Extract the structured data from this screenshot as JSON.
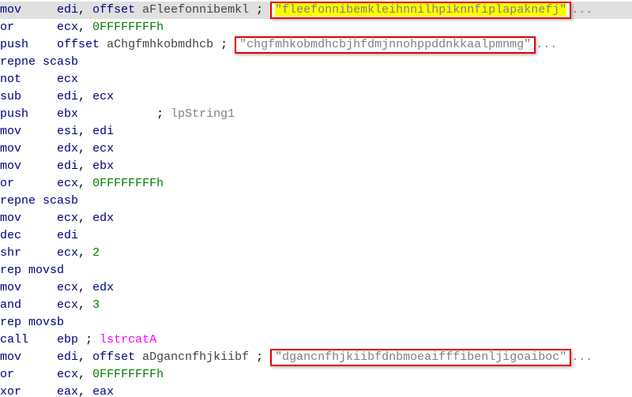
{
  "lines": [
    {
      "mnemonic": "mov",
      "ops": [
        "edi",
        "offset aFleefonnibemkl"
      ],
      "highlight": true,
      "comment_boxed": true,
      "comment_hl": true,
      "comment": "\"fleefonnibemkleihnnilhpiknnfiplapaknefj\"",
      "trail": "..."
    },
    {
      "mnemonic": "or",
      "ops": [
        "ecx",
        "0FFFFFFFFh"
      ]
    },
    {
      "mnemonic": "push",
      "ops": [
        "offset aChgfmhkobmdhcb"
      ],
      "comment_boxed": true,
      "comment": "\"chgfmhkobmdhcbjhfdmjnnohppddnkkaalpmnmg\"",
      "trail": "..."
    },
    {
      "mnemonic": "repne scasb",
      "ops": []
    },
    {
      "mnemonic": "not",
      "ops": [
        "ecx"
      ]
    },
    {
      "mnemonic": "sub",
      "ops": [
        "edi",
        "ecx"
      ]
    },
    {
      "mnemonic": "push",
      "ops": [
        "ebx"
      ],
      "comment": "lpString1",
      "comment_plain": true
    },
    {
      "mnemonic": "mov",
      "ops": [
        "esi",
        "edi"
      ]
    },
    {
      "mnemonic": "mov",
      "ops": [
        "edx",
        "ecx"
      ]
    },
    {
      "mnemonic": "mov",
      "ops": [
        "edi",
        "ebx"
      ]
    },
    {
      "mnemonic": "or",
      "ops": [
        "ecx",
        "0FFFFFFFFh"
      ]
    },
    {
      "mnemonic": "repne scasb",
      "ops": []
    },
    {
      "mnemonic": "mov",
      "ops": [
        "ecx",
        "edx"
      ]
    },
    {
      "mnemonic": "dec",
      "ops": [
        "edi"
      ]
    },
    {
      "mnemonic": "shr",
      "ops": [
        "ecx",
        "2"
      ]
    },
    {
      "mnemonic": "rep movsd",
      "ops": []
    },
    {
      "mnemonic": "mov",
      "ops": [
        "ecx",
        "edx"
      ]
    },
    {
      "mnemonic": "and",
      "ops": [
        "ecx",
        "3"
      ]
    },
    {
      "mnemonic": "rep movsb",
      "ops": []
    },
    {
      "mnemonic": "call",
      "ops": [
        "ebp"
      ],
      "call_comment": "lstrcatA"
    },
    {
      "mnemonic": "mov",
      "ops": [
        "edi",
        "offset aDgancnfhjkiibf"
      ],
      "comment_boxed": true,
      "comment": "\"dgancnfhjkiibfdnbmoeaifffibenljigoaiboc\"",
      "trail": "..."
    },
    {
      "mnemonic": "or",
      "ops": [
        "ecx",
        "0FFFFFFFFh"
      ]
    },
    {
      "mnemonic": "xor",
      "ops": [
        "eax",
        "eax"
      ]
    }
  ],
  "keywords": {
    "offset": "offset"
  },
  "columns": {
    "mnemonic_pad": 8,
    "comment_col": 20
  }
}
